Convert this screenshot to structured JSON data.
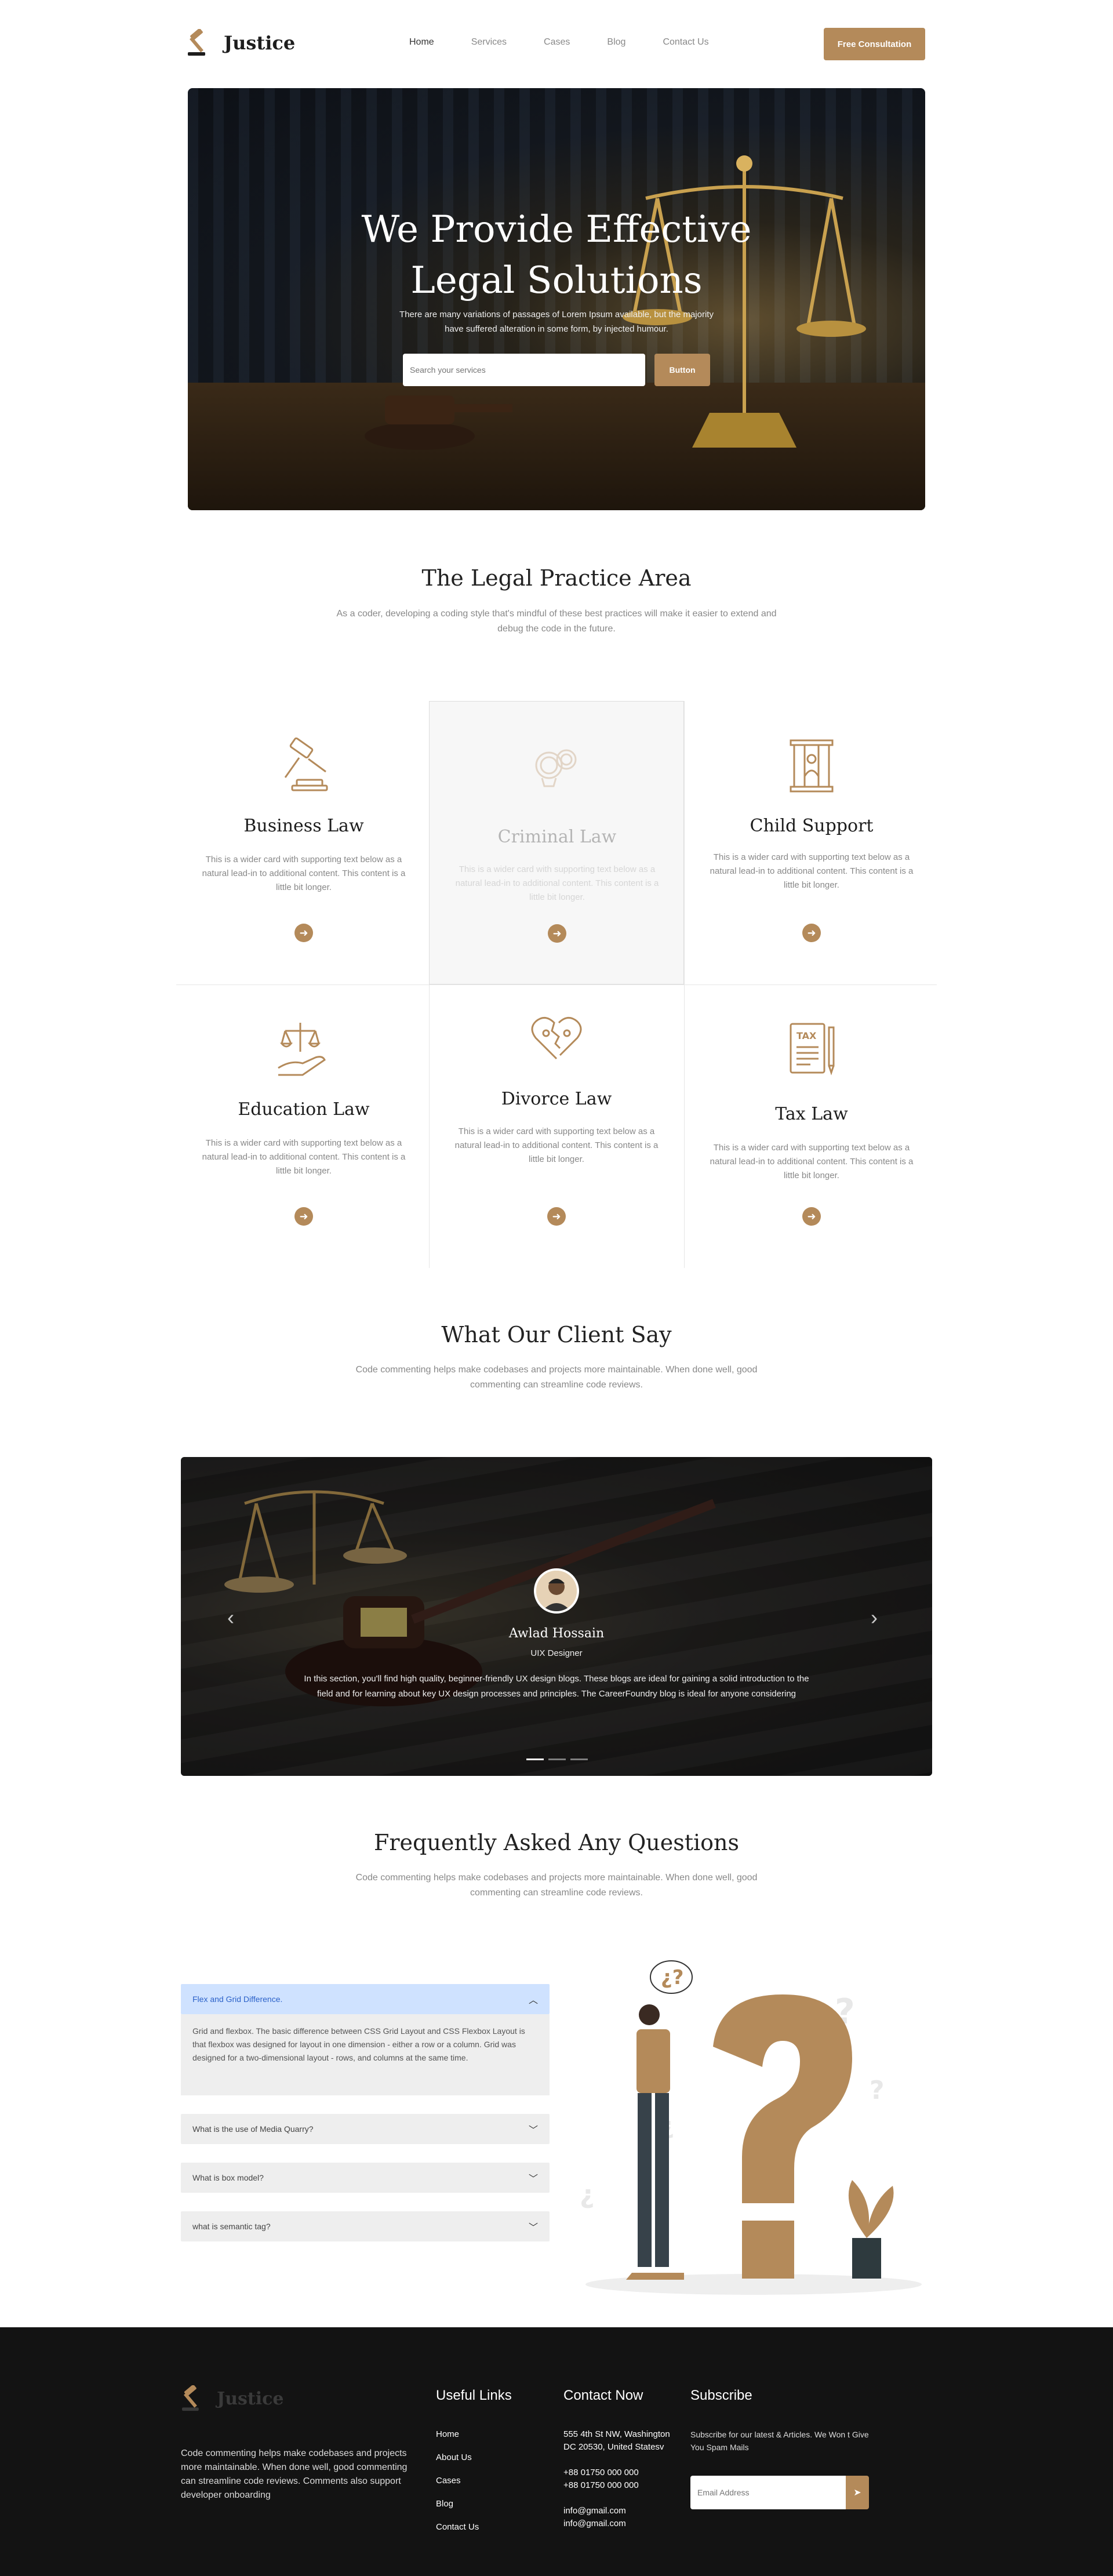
{
  "brand": {
    "name": "Justice",
    "accent": "#b48a5a"
  },
  "nav": {
    "items": [
      {
        "label": "Home"
      },
      {
        "label": "Services"
      },
      {
        "label": "Cases"
      },
      {
        "label": "Blog"
      },
      {
        "label": "Contact Us"
      }
    ],
    "cta_label": "Free Consultation"
  },
  "hero": {
    "title_line1": "We Provide Effective",
    "title_line2": "Legal Solutions",
    "subtitle": "There are many variations of passages of Lorem Ipsum available, but the majority have suffered alteration in some form, by injected humour.",
    "search_placeholder": "Search your services",
    "search_button": "Button"
  },
  "practice": {
    "title": "The Legal Practice Area",
    "subtitle": "As a coder, developing a coding style that's mindful of these best practices will make it easier to extend and debug the code in the future.",
    "cards": [
      {
        "title": "Business Law",
        "text": "This is a wider card with supporting text below as a natural lead-in to additional content. This content is a little bit longer.",
        "icon": "gavel-icon"
      },
      {
        "title": "Criminal Law",
        "text": "This is a wider card with supporting text below as a natural lead-in to additional content. This content is a little bit longer.",
        "icon": "handcuffs-icon"
      },
      {
        "title": "Child Support",
        "text": "This is a wider card with supporting text below as a natural lead-in to additional content. This content is a little bit longer.",
        "icon": "family-icon"
      },
      {
        "title": "Education Law",
        "text": "This is a wider card with supporting text below as a natural lead-in to additional content. This content is a little bit longer.",
        "icon": "scales-hand-icon"
      },
      {
        "title": "Divorce Law",
        "text": "This is a wider card with supporting text below as a natural lead-in to additional content. This content is a little bit longer.",
        "icon": "broken-heart-icon"
      },
      {
        "title": "Tax Law",
        "text": "This is a wider card with supporting text below as a natural lead-in to additional content. This content is a little bit longer.",
        "icon": "tax-document-icon"
      }
    ]
  },
  "clients": {
    "title": "What Our Client Say",
    "subtitle": "Code commenting helps make codebases and projects more maintainable. When done well, good commenting can streamline code reviews.",
    "testimonial": {
      "name": "Awlad Hossain",
      "role": "UIX Designer",
      "quote": "In this section, you'll find high quality, beginner-friendly UX design blogs. These blogs are ideal for gaining a solid introduction to the field and for learning about key UX design processes and principles. The CareerFoundry blog is ideal for anyone considering"
    }
  },
  "faq": {
    "title": "Frequently Asked Any Questions",
    "subtitle": "Code commenting helps make codebases and projects more maintainable. When done well, good commenting can streamline code reviews.",
    "items": [
      {
        "q": "Flex and Grid Difference.",
        "a": "Grid and flexbox. The basic difference between CSS Grid Layout and CSS Flexbox Layout is that flexbox was designed for layout in one dimension - either a row or a column. Grid was designed for a two-dimensional layout - rows, and columns at the same time."
      },
      {
        "q": "What is the use of Media Quarry?"
      },
      {
        "q": "What is box model?"
      },
      {
        "q": "what is semantic tag?"
      }
    ]
  },
  "footer": {
    "brand": "Justice",
    "description": "Code commenting helps make codebases and projects more maintainable. When done well, good commenting can streamline code reviews. Comments also support developer onboarding",
    "links_title": "Useful Links",
    "links": [
      "Home",
      "About Us",
      "Cases",
      "Blog",
      "Contact Us"
    ],
    "contact_title": "Contact Now",
    "address": "555 4th St NW, Washington DC 20530, United Statesv",
    "phone1": "+88 01750 000 000",
    "phone2": "+88 01750 000 000",
    "email1": "info@gmail.com",
    "email2": "info@gmail.com",
    "subscribe_title": "Subscribe",
    "subscribe_text": "Subscribe for our latest & Articles. We Won t Give You Spam Mails",
    "email_placeholder": "Email Address"
  }
}
